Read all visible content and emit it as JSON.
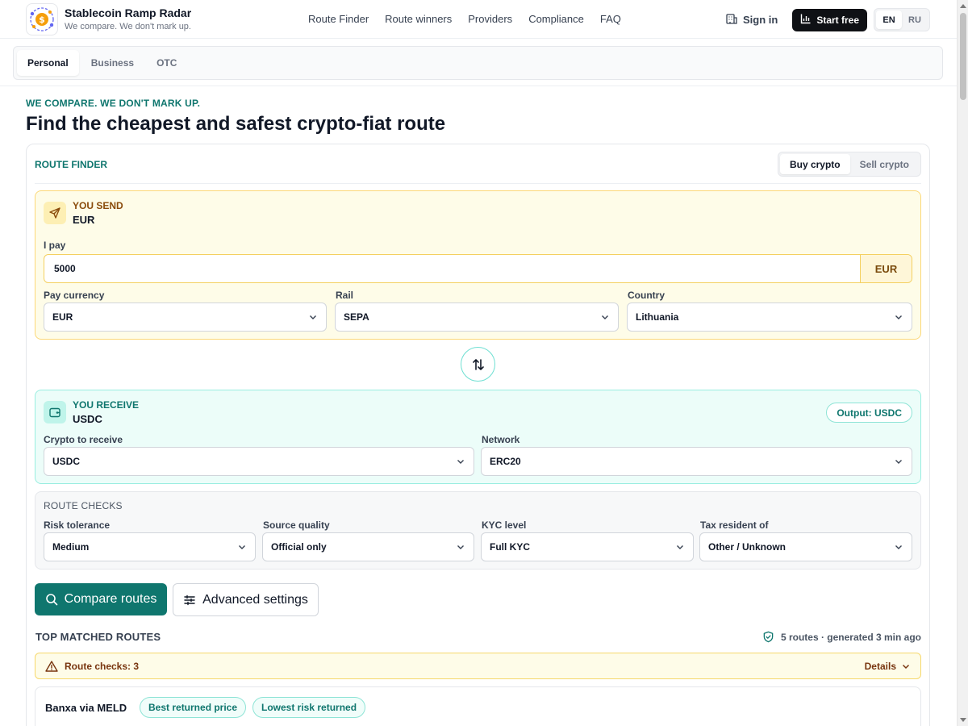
{
  "brand": {
    "title": "Stablecoin Ramp Radar",
    "subtitle": "We compare. We don't mark up."
  },
  "nav": {
    "items": [
      {
        "label": "Route Finder"
      },
      {
        "label": "Route winners"
      },
      {
        "label": "Providers"
      },
      {
        "label": "Compliance"
      },
      {
        "label": "FAQ"
      }
    ]
  },
  "header": {
    "sign_in": "Sign in",
    "start_free": "Start free",
    "languages": [
      "EN",
      "RU"
    ],
    "active_language": "EN"
  },
  "segments": {
    "items": [
      {
        "label": "Personal"
      },
      {
        "label": "Business"
      },
      {
        "label": "OTC"
      }
    ],
    "active": "Personal"
  },
  "hero": {
    "eyebrow": "WE COMPARE. WE DON'T MARK UP.",
    "title": "Find the cheapest and safest crypto-fiat route"
  },
  "route_finder": {
    "title": "ROUTE FINDER",
    "modes": [
      "Buy crypto",
      "Sell crypto"
    ],
    "active_mode": "Buy crypto",
    "send": {
      "label": "YOU SEND",
      "value": "EUR",
      "amount_label": "I pay",
      "amount_value": "5000",
      "amount_currency": "EUR",
      "pay_currency_label": "Pay currency",
      "pay_currency_value": "EUR",
      "rail_label": "Rail",
      "rail_value": "SEPA",
      "country_label": "Country",
      "country_value": "Lithuania"
    },
    "receive": {
      "label": "YOU RECEIVE",
      "value": "USDC",
      "output_badge": "Output: USDC",
      "crypto_label": "Crypto to receive",
      "crypto_value": "USDC",
      "network_label": "Network",
      "network_value": "ERC20"
    },
    "checks": {
      "title": "ROUTE CHECKS",
      "risk_label": "Risk tolerance",
      "risk_value": "Medium",
      "source_label": "Source quality",
      "source_value": "Official only",
      "kyc_label": "KYC level",
      "kyc_value": "Full KYC",
      "tax_label": "Tax resident of",
      "tax_value": "Other / Unknown"
    },
    "compare_button": "Compare routes",
    "advanced_button": "Advanced settings"
  },
  "results": {
    "title": "TOP MATCHED ROUTES",
    "meta": "5 routes · generated 3 min ago",
    "checks_notice": "Route checks: 3",
    "details_label": "Details",
    "first": {
      "name": "Banxa via MELD",
      "tags": [
        "Best returned price",
        "Lowest risk returned"
      ]
    }
  },
  "colors": {
    "accent": "#0f766e",
    "send_bg": "#fefce8",
    "receive_bg": "#ecfdf9",
    "warning_text": "#78350f"
  }
}
